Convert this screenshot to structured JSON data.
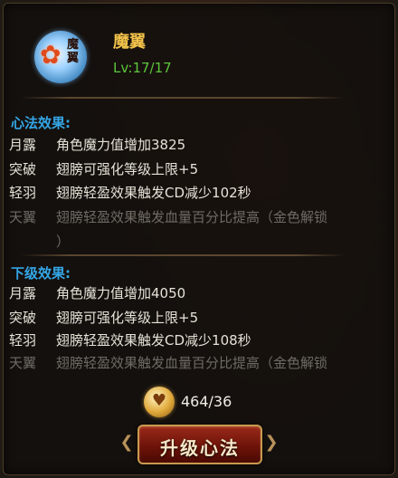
{
  "skill": {
    "name": "魔翼",
    "level": "Lv:17/17",
    "icon": "wing-flower-icon",
    "icon_glyph": "魔翼"
  },
  "sections": [
    {
      "heading": "心法效果:",
      "effects": [
        {
          "name": "月露",
          "text": "角色魔力值增加3825",
          "locked": false
        },
        {
          "name": "突破",
          "text": "翅膀可强化等级上限+5",
          "locked": false
        },
        {
          "name": "轻羽",
          "text": "翅膀轻盈效果触发CD减少102秒",
          "locked": false
        },
        {
          "name": "天翼",
          "text": "翅膀轻盈效果触发血量百分比提高（金色解锁",
          "continuation": "）",
          "locked": true
        }
      ]
    },
    {
      "heading": "下级效果:",
      "effects": [
        {
          "name": "月露",
          "text": "角色魔力值增加4050",
          "locked": false
        },
        {
          "name": "突破",
          "text": "翅膀可强化等级上限+5",
          "locked": false
        },
        {
          "name": "轻羽",
          "text": "翅膀轻盈效果触发CD减少108秒",
          "locked": false
        },
        {
          "name": "天翼",
          "text": "翅膀轻盈效果触发血量百分比提高（金色解锁",
          "locked": true
        }
      ]
    }
  ],
  "cost": {
    "icon": "heart-coin-icon",
    "text": "464/36"
  },
  "upgrade_button": {
    "label": "升级心法"
  },
  "colors": {
    "title": "#f2c24a",
    "level": "#5cc53c",
    "section_heading": "#34a6e6",
    "effect_text": "#e6e2d8",
    "locked_text": "#6e6a64"
  }
}
